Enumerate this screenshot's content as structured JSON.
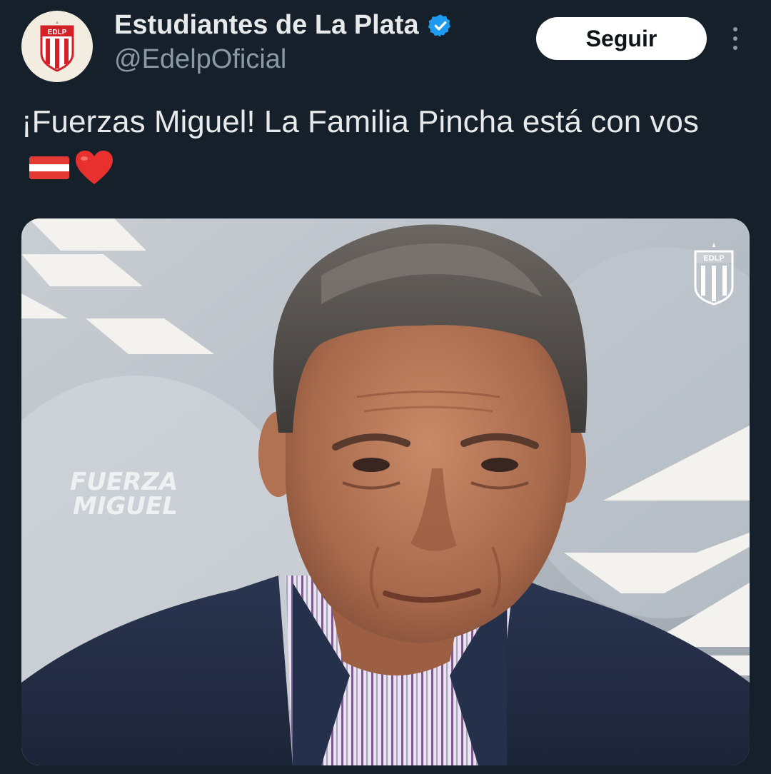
{
  "tweet": {
    "author": {
      "display_name": "Estudiantes de La Plata",
      "handle": "@EdelpOficial",
      "verified": true,
      "avatar_text": "EDLP"
    },
    "follow_label": "Seguir",
    "text": "¡Fuerzas Miguel! La Familia Pincha está con vos",
    "emojis": [
      "flag-red-white-red",
      "red-heart"
    ],
    "media": {
      "overlay_text_line1": "FUERZA",
      "overlay_text_line2": "MIGUEL",
      "badge_text": "EDLP"
    }
  },
  "colors": {
    "background": "#15202b",
    "verified_blue": "#1d9bf0",
    "follow_button_bg": "#ffffff",
    "secondary_text": "#8b98a5",
    "club_red": "#d42027"
  }
}
